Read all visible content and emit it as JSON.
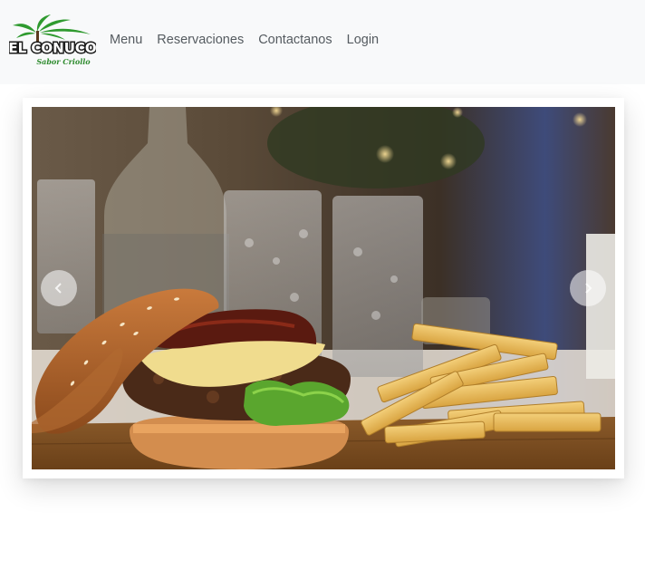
{
  "brand": {
    "name": "EL CONUCO",
    "tagline": "Sabor Criollo",
    "accent": "#2e8b2e"
  },
  "nav": {
    "items": [
      {
        "label": "Menu"
      },
      {
        "label": "Reservaciones"
      },
      {
        "label": "Contactanos"
      },
      {
        "label": "Login"
      }
    ]
  },
  "carousel": {
    "slide_subject": "burger-and-fries-photo",
    "prev_icon": "chevron-left-icon",
    "next_icon": "chevron-right-icon"
  }
}
